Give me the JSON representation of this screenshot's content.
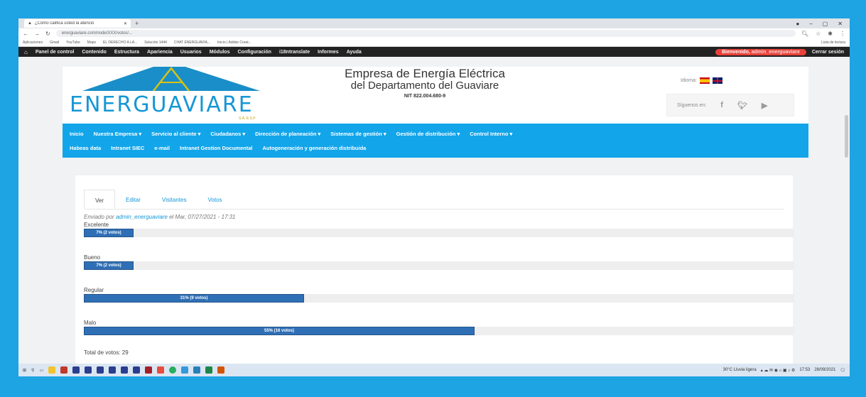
{
  "browser": {
    "tab_title": "¿Cómo califica usted la atenció",
    "url": "energuaviare.com/node/XXX/votos/...",
    "bookmarks": [
      "Aplicaciones",
      "Gmail",
      "YouTube",
      "Maps",
      "EL DERECHO A LA...",
      "Solución 1444",
      "CHAT ENERGUAVIA...",
      "Inicio | Adobe Creat..."
    ],
    "reading_list": "Lista de lectura"
  },
  "admin_toolbar": {
    "items": [
      "Panel de control",
      "Contenido",
      "Estructura",
      "Apariencia",
      "Usuarios",
      "Módulos",
      "Configuración",
      "i18ntranslate",
      "Informes",
      "Ayuda"
    ],
    "welcome": "Bienvenido,",
    "username": "admin_energuaviare",
    "logout": "Cerrar sesión"
  },
  "header": {
    "logo_text": "ENERGUAVIARE",
    "logo_sub": "S.A. E.S.P",
    "company_line1": "Empresa de Energía Eléctrica",
    "company_line2": "del Departamento del Guaviare",
    "nit": "NIT 822.004.680-9",
    "language_label": "Idioma:",
    "follow_label": "Síguenos en:"
  },
  "nav": {
    "row1": [
      "Inicio",
      "Nuestra Empresa ▾",
      "Servicio al cliente ▾",
      "Ciudadanos ▾",
      "Dirección de planeación ▾",
      "Sistemas de gestión ▾",
      "Gestión de distribución ▾",
      "Control Interno ▾"
    ],
    "row2": [
      "Habeas data",
      "Intranet SIEC",
      "e-mail",
      "Intranet Gestion Documental",
      "Autogeneración y generación distribuida"
    ]
  },
  "tabs": [
    "Ver",
    "Editar",
    "Visitantes",
    "Votos"
  ],
  "submitted": {
    "prefix": "Enviado por",
    "author": "admin_energuaviare",
    "suffix": "el Mar, 07/27/2021 - 17:31"
  },
  "poll": [
    {
      "label": "Excelente",
      "fraction": 0.07,
      "text": "7% (2 votos)"
    },
    {
      "label": "Bueno",
      "fraction": 0.07,
      "text": "7% (2 votos)"
    },
    {
      "label": "Regular",
      "fraction": 0.31,
      "text": "31% (9 votos)"
    },
    {
      "label": "Malo",
      "fraction": 0.55,
      "text": "55% (16 votos)"
    }
  ],
  "total": "Total de votos: 29",
  "taskbar": {
    "weather": "30°C Lluvia ligera",
    "time": "17:53",
    "date": "28/09/2021"
  }
}
